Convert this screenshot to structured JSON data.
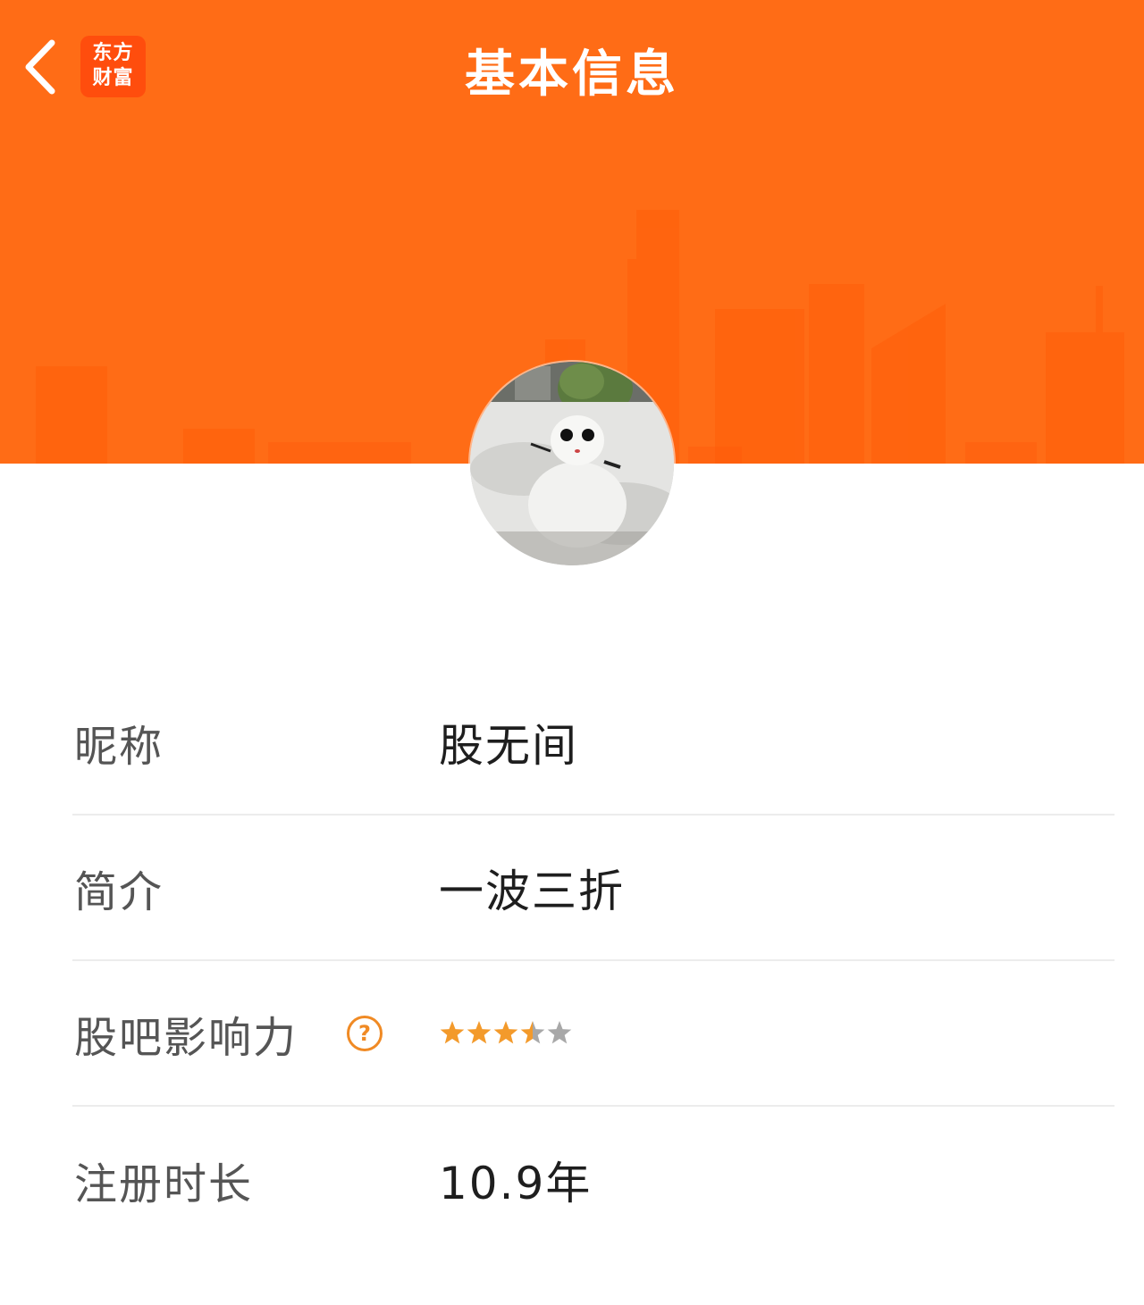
{
  "header": {
    "title": "基本信息",
    "logo_line1": "东方",
    "logo_line2": "财富",
    "back_icon": "chevron-left-icon",
    "background_color": "#ff6a14"
  },
  "profile": {
    "avatar": "snowman-photo"
  },
  "info_rows": [
    {
      "label": "昵称",
      "value": "股无间"
    },
    {
      "label": "简介",
      "value": "一波三折"
    },
    {
      "label": "股吧影响力",
      "help_icon": "question-circle-icon",
      "help_symbol": "?",
      "rating": 3.5,
      "rating_max": 5
    },
    {
      "label": "注册时长",
      "value": "10.9年"
    }
  ],
  "colors": {
    "accent": "#f08a24",
    "star_filled": "#f39a2b",
    "star_empty": "#a8a8a8",
    "label_text": "#555555",
    "value_text": "#1e1e1e"
  }
}
